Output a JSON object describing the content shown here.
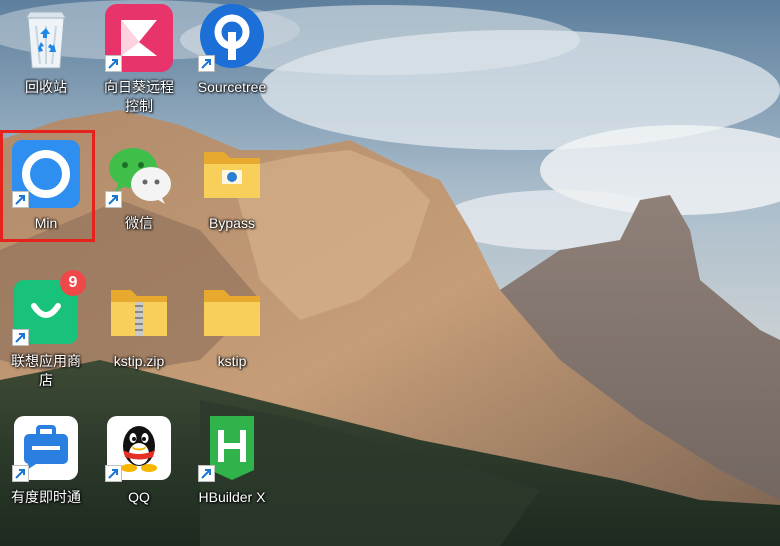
{
  "desktop": {
    "colors": {
      "selection": "#e5231c",
      "label_text": "#ffffff"
    },
    "icons": [
      {
        "label": "回收站",
        "icon": "recycle-bin-icon",
        "shortcut": false
      },
      {
        "label": "向日葵远程控制",
        "icon": "sunlogin-icon",
        "shortcut": true
      },
      {
        "label": "Sourcetree",
        "icon": "sourcetree-icon",
        "shortcut": true
      },
      {
        "label": "Min",
        "icon": "min-browser-icon",
        "shortcut": true,
        "selected": true
      },
      {
        "label": "微信",
        "icon": "wechat-icon",
        "shortcut": true
      },
      {
        "label": "Bypass",
        "icon": "folder-icon",
        "shortcut": false
      },
      {
        "label": "联想应用商店",
        "icon": "lenovo-app-store-icon",
        "shortcut": true,
        "badge": "9"
      },
      {
        "label": "kstip.zip",
        "icon": "zip-folder-icon",
        "shortcut": false
      },
      {
        "label": "kstip",
        "icon": "folder-icon",
        "shortcut": false
      },
      {
        "label": "有度即时通",
        "icon": "youdu-icon",
        "shortcut": true
      },
      {
        "label": "QQ",
        "icon": "qq-icon",
        "shortcut": true
      },
      {
        "label": "HBuilder X",
        "icon": "hbuilderx-icon",
        "shortcut": true
      }
    ]
  }
}
